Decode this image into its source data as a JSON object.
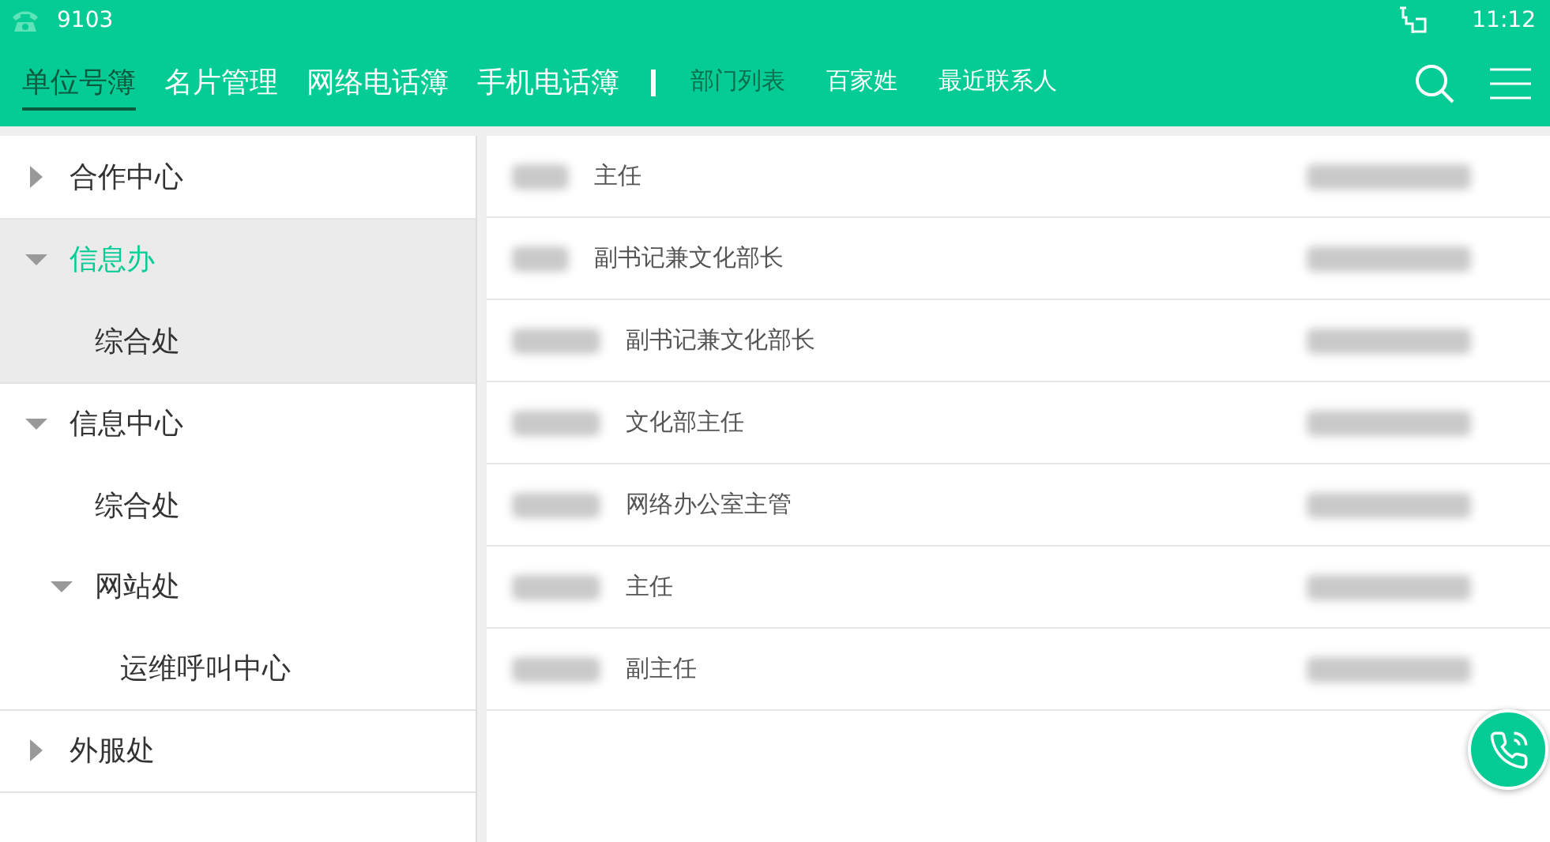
{
  "status_bar": {
    "line": "9103",
    "time": "11:12"
  },
  "nav": {
    "tabs": [
      {
        "label": "单位号簿",
        "kind": "main",
        "selected": true
      },
      {
        "label": "名片管理",
        "kind": "main",
        "selected": false
      },
      {
        "label": "网络电话簿",
        "kind": "main",
        "selected": false
      },
      {
        "label": "手机电话簿",
        "kind": "main",
        "selected": false
      },
      {
        "label": "部门列表",
        "kind": "sub",
        "selected": true
      },
      {
        "label": "百家姓",
        "kind": "sub",
        "selected": false
      },
      {
        "label": "最近联系人",
        "kind": "sub",
        "selected": false
      }
    ]
  },
  "tree": [
    {
      "label": "合作中心",
      "expanded": false,
      "selected": false
    },
    {
      "label": "信息办",
      "expanded": true,
      "selected": true,
      "children": [
        {
          "label": "综合处",
          "selected": false
        }
      ]
    },
    {
      "label": "信息中心",
      "expanded": true,
      "selected": false,
      "children": [
        {
          "label": "综合处",
          "selected": false
        },
        {
          "label": "网站处",
          "expanded": true,
          "selected": false,
          "children": [
            {
              "label": "运维呼叫中心",
              "selected": false
            }
          ]
        }
      ]
    },
    {
      "label": "外服处",
      "expanded": false,
      "selected": false
    }
  ],
  "contacts": [
    {
      "title": "主任"
    },
    {
      "title": "副书记兼文化部长"
    },
    {
      "title": "副书记兼文化部长"
    },
    {
      "title": "文化部主任"
    },
    {
      "title": "网络办公室主管"
    },
    {
      "title": "主任"
    },
    {
      "title": "副主任"
    }
  ]
}
